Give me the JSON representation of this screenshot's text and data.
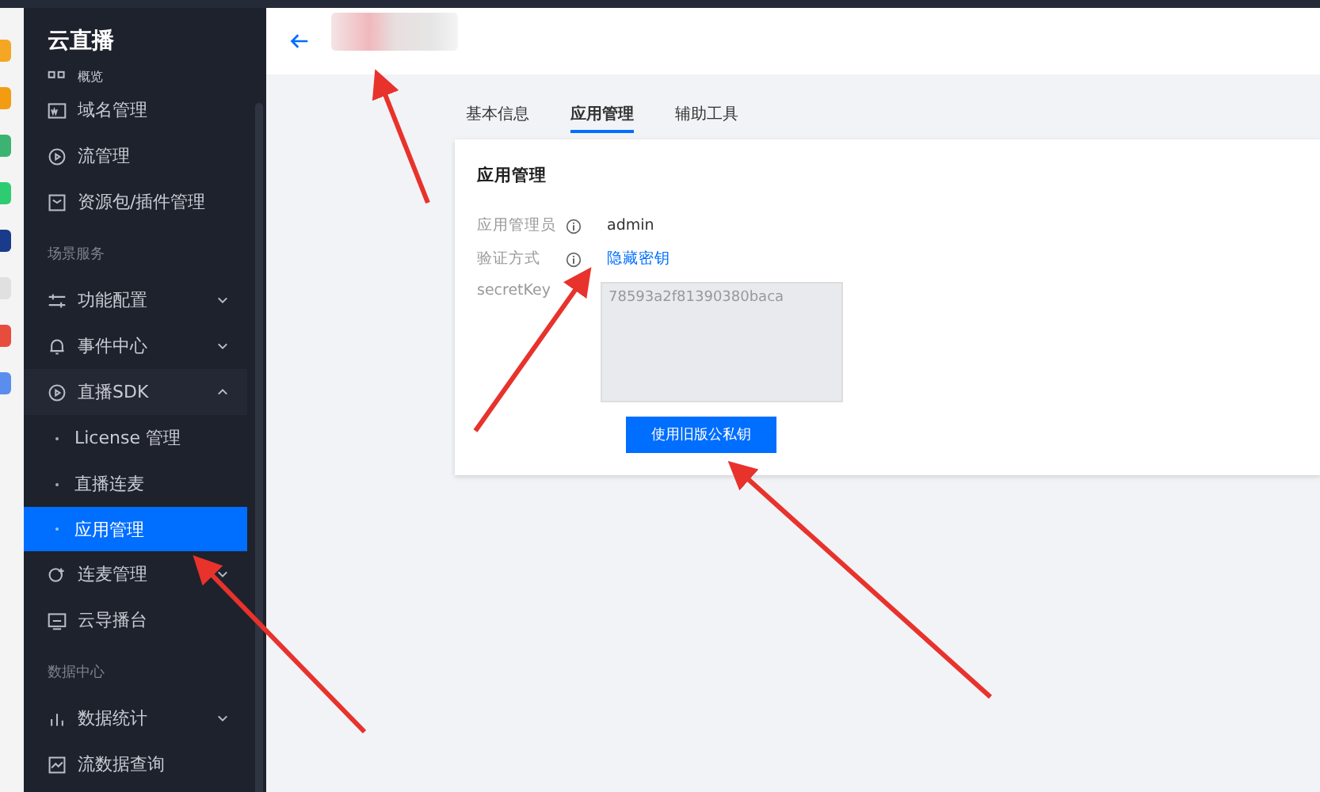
{
  "sidebar": {
    "title": "云直播",
    "items": [
      {
        "kind": "item",
        "label": "概览",
        "selected": false
      },
      {
        "kind": "item",
        "label": "域名管理",
        "selected": false
      },
      {
        "kind": "item",
        "label": "流管理",
        "selected": false
      },
      {
        "kind": "item",
        "label": "资源包/插件管理",
        "selected": false
      },
      {
        "kind": "group",
        "label": "场景服务"
      },
      {
        "kind": "menu",
        "label": "功能配置",
        "expanded": false
      },
      {
        "kind": "menu",
        "label": "事件中心",
        "expanded": false
      },
      {
        "kind": "menu",
        "label": "直播SDK",
        "expanded": true
      },
      {
        "kind": "sub",
        "label": "License 管理",
        "selected": false
      },
      {
        "kind": "sub",
        "label": "直播连麦",
        "selected": false
      },
      {
        "kind": "sub",
        "label": "应用管理",
        "selected": true
      },
      {
        "kind": "menu",
        "label": "连麦管理",
        "expanded": false
      },
      {
        "kind": "item",
        "label": "云导播台",
        "selected": false
      },
      {
        "kind": "group",
        "label": "数据中心"
      },
      {
        "kind": "menu",
        "label": "数据统计",
        "expanded": false
      },
      {
        "kind": "item",
        "label": "流数据查询",
        "selected": false
      }
    ]
  },
  "tabs": [
    {
      "label": "基本信息",
      "selected": false
    },
    {
      "label": "应用管理",
      "selected": true
    },
    {
      "label": "辅助工具",
      "selected": false
    }
  ],
  "card": {
    "title": "应用管理",
    "admin": {
      "label": "应用管理员",
      "value": "admin"
    },
    "auth": {
      "label": "验证方式",
      "link": "隐藏密钥"
    },
    "secret": {
      "label": "secretKey",
      "value": "78593a2f81390380baca"
    },
    "button": "使用旧版公私钥"
  }
}
